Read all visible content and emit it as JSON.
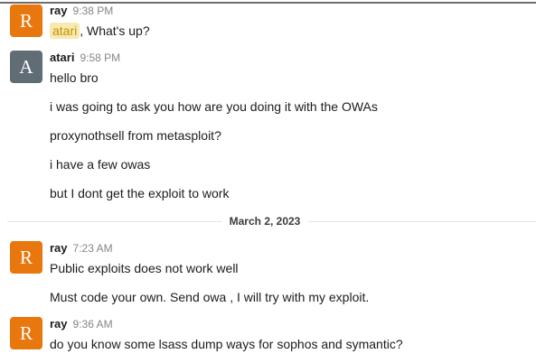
{
  "messages": [
    {
      "avatar_letter": "R",
      "author": "ray",
      "time": "9:38 PM",
      "mention": "atari",
      "text": ", What's up?"
    },
    {
      "avatar_letter": "A",
      "author": "atari",
      "time": "9:58 PM",
      "lines": [
        "hello bro",
        "i was going to ask you how are you doing it with the OWAs",
        "proxynothsell from metasploit?",
        "i have a few owas",
        "but I dont get the exploit to work"
      ]
    },
    {
      "avatar_letter": "R",
      "author": "ray",
      "time": "7:23 AM",
      "lines": [
        "Public exploits does not work well",
        "Must code your own. Send owa , I will try with my exploit."
      ]
    },
    {
      "avatar_letter": "R",
      "author": "ray",
      "time": "9:36 AM",
      "lines": [
        "do you know some lsass dump ways for sophos and symantic?"
      ]
    }
  ],
  "date_divider": "March 2, 2023",
  "colors": {
    "orange_avatar": "#e8780e",
    "gray_avatar": "#616d75",
    "mention_bg": "#f6eab1",
    "mention_text": "#c59000"
  }
}
